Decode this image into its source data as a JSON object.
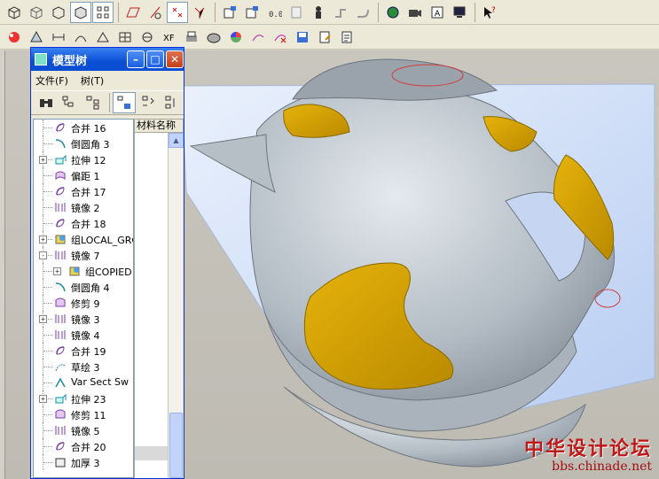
{
  "toolbar_top": {
    "icons": [
      "view-box-icon",
      "view-box-hidden-icon",
      "view-box-front-icon",
      "view-shaded-icon",
      "view-orient-icon",
      "datum-plane-icon",
      "datum-axis-icon",
      "datum-point-icon",
      "datum-csys-icon",
      "save-view-icon",
      "layer-icon",
      "model-icon",
      "info-icon",
      "person-icon",
      "pipe-icon",
      "pipe2-icon",
      "globe-icon",
      "camera-icon",
      "annotation-icon",
      "monitor-icon",
      "help-arrow-icon"
    ]
  },
  "toolbar_second": {
    "icons": [
      "color-wheel-icon",
      "layer-sketch-icon",
      "dimension-icon",
      "arc-tool-icon",
      "triangle-tool-icon",
      "table-tool-icon",
      "circle-tool-icon",
      "xf-tool-icon",
      "print-icon",
      "rendering-icon",
      "palette-icon",
      "edit-pen-icon",
      "delete-pen-icon",
      "save-model-icon",
      "notebook-icon",
      "checklist-icon"
    ]
  },
  "model_tree": {
    "title": "模型树",
    "menu": [
      "文件(F)",
      "树(T)"
    ],
    "column_header": "材料名称",
    "items": [
      {
        "label": "合并 16",
        "icon": "merge-icon",
        "expander": ""
      },
      {
        "label": "倒圆角 3",
        "icon": "round-icon",
        "expander": ""
      },
      {
        "label": "拉伸 12",
        "icon": "extrude-icon",
        "expander": "+"
      },
      {
        "label": "偏距 1",
        "icon": "offset-icon",
        "expander": ""
      },
      {
        "label": "合并 17",
        "icon": "merge-icon",
        "expander": ""
      },
      {
        "label": "镜像 2",
        "icon": "mirror-icon",
        "expander": ""
      },
      {
        "label": "合并 18",
        "icon": "merge-icon",
        "expander": ""
      },
      {
        "label": "组LOCAL_GRO",
        "icon": "group-icon",
        "expander": "+"
      },
      {
        "label": "镜像 7",
        "icon": "mirror-icon",
        "expander": "−"
      },
      {
        "label": "组COPIED",
        "icon": "group-icon",
        "expander": "+",
        "indent": true
      },
      {
        "label": "倒圆角 4",
        "icon": "round-icon",
        "expander": ""
      },
      {
        "label": "修剪 9",
        "icon": "trim-icon",
        "expander": ""
      },
      {
        "label": "镜像 3",
        "icon": "mirror-icon",
        "expander": "+"
      },
      {
        "label": "镜像 4",
        "icon": "mirror-icon",
        "expander": ""
      },
      {
        "label": "合并 19",
        "icon": "merge-icon",
        "expander": ""
      },
      {
        "label": "草绘 3",
        "icon": "sketch-icon",
        "expander": ""
      },
      {
        "label": "Var Sect Sw",
        "icon": "sweep-icon",
        "expander": ""
      },
      {
        "label": "拉伸 23",
        "icon": "extrude-icon",
        "expander": "+"
      },
      {
        "label": "修剪 11",
        "icon": "trim-icon",
        "expander": ""
      },
      {
        "label": "镜像 5",
        "icon": "mirror-icon",
        "expander": ""
      },
      {
        "label": "合并 20",
        "icon": "merge-icon",
        "expander": ""
      },
      {
        "label": "加厚 3",
        "icon": "thicken-icon",
        "expander": ""
      }
    ]
  },
  "watermark": {
    "cn": "中华设计论坛",
    "en": "bbs.chinade.net"
  },
  "colors": {
    "title_bar": "#0a4fd3",
    "model_body": "#b4bcc3",
    "accent_yellow": "#d6a600",
    "plane": "#d2e1fa"
  }
}
